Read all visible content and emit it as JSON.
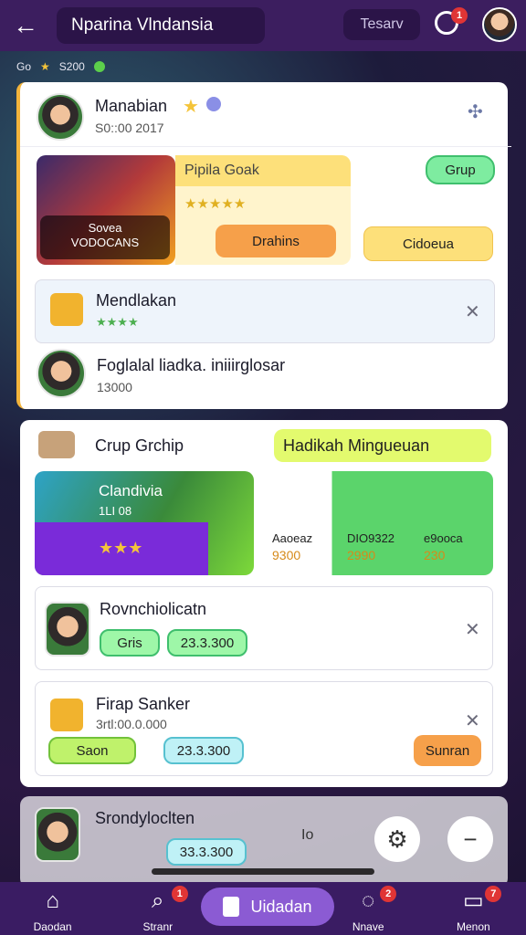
{
  "topbar": {
    "title": "Nparina Vlndansia",
    "tab": "Tesarv",
    "notification_count": "1"
  },
  "status": {
    "left": "Go",
    "right": "S200"
  },
  "card1": {
    "user_name": "Manabian",
    "user_time": "S0::00 2017",
    "promo_title": "Pipila Goak",
    "promo_overlay_line1": "Sovea",
    "promo_overlay_line2": "VODOCANS",
    "button_grup": "Grup",
    "button_drahins": "Drahins",
    "button_cidoeua": "Cidoeua",
    "item_title": "Mendlakan",
    "item_sub": "★★★★",
    "friend_title": "Foglalal liadka. iniiirglosar",
    "friend_sub": "13000"
  },
  "card2": {
    "group_title": "Crup Grchip",
    "group_right_label": "Hadikah Mingueuan",
    "hero_title": "Clandivia",
    "hero_sub": "1LI 08",
    "item_reward_a_name": "Aaoeaz",
    "item_reward_a_val": "9300",
    "item_reward_b_name": "DIO9322",
    "item_reward_b_val": "2990",
    "item_reward_c_name": "e9ooca",
    "item_reward_c_val": "230",
    "row1_title": "Rovnchiolicatn",
    "row1_btn_a": "Gris",
    "row1_btn_b": "23.3.300",
    "row2_title": "Firap Sanker",
    "row2_sub": "3rtl:00.0.000",
    "row2_btn_a": "Saon",
    "row2_btn_b": "23.3.300",
    "row2_btn_c": "Sunran"
  },
  "card3": {
    "title": "Srondyloclten",
    "btn_value": "33.3.300"
  },
  "fab": {
    "value_label": "Io"
  },
  "bottomnav": {
    "items": [
      {
        "label": "Daodan",
        "badge": ""
      },
      {
        "label": "Stranr",
        "badge": "1"
      },
      {
        "label": "Uidadan",
        "badge": ""
      },
      {
        "label": "Nnave",
        "badge": "2"
      },
      {
        "label": "Menon",
        "badge": "7"
      }
    ]
  },
  "colors": {
    "topbar": "#3c1e5f",
    "accent": "#8b5bd3",
    "card_left_border": "#f3b43b",
    "gold_star": "#f4c43a",
    "green": "#3fbf6d",
    "orange": "#f6a04a"
  }
}
